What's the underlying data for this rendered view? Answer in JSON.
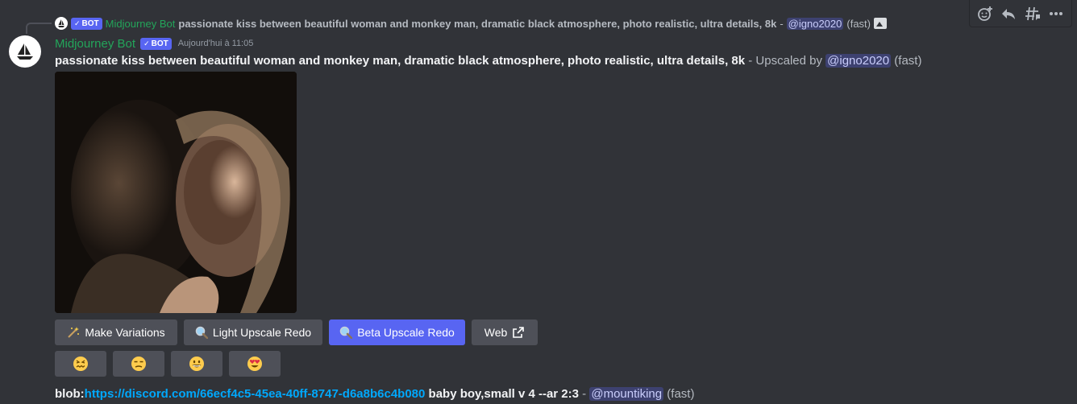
{
  "reply": {
    "bot_tag": "BOT",
    "author": "Midjourney Bot",
    "prompt": "passionate kiss between beautiful woman and monkey man, dramatic black atmosphere, photo realistic, ultra details, 8k",
    "separator": "-",
    "mention": "@igno2020",
    "speed": "(fast)",
    "attachment_icon": "image-icon"
  },
  "message": {
    "author": "Midjourney Bot",
    "bot_tag": "BOT",
    "timestamp": "Aujourd'hui à 11:05",
    "prompt": "passionate kiss between beautiful woman and monkey man, dramatic black atmosphere, photo realistic, ultra details, 8k",
    "suffix": " - Upscaled by ",
    "mention": "@igno2020",
    "speed": "(fast)"
  },
  "buttons": [
    {
      "label": "Make Variations",
      "icon": "sparkles-icon"
    },
    {
      "label": "Light Upscale Redo",
      "icon": "magnifier-icon"
    },
    {
      "label": "Beta Upscale Redo",
      "icon": "magnifier-icon"
    },
    {
      "label": "Web",
      "icon": "external-link-icon"
    }
  ],
  "reactions": [
    "confounded-face",
    "unamused-face",
    "grinning-face",
    "heart-eyes-face"
  ],
  "next_message": {
    "prefix": "blob:",
    "link": "https://discord.com/66ecf4c5-45ea-40ff-8747-d6a8b6c4b080",
    "text": " baby boy,small v 4 --ar 2:3",
    "separator": " - ",
    "mention": "@mountiking",
    "speed": "(fast)"
  },
  "toolbar": [
    "add-reaction-icon",
    "reply-icon",
    "create-thread-icon",
    "more-icon"
  ],
  "colors": {
    "background": "#313338",
    "accent": "#5865f2",
    "author": "#23a55a",
    "link": "#00a8fc"
  }
}
